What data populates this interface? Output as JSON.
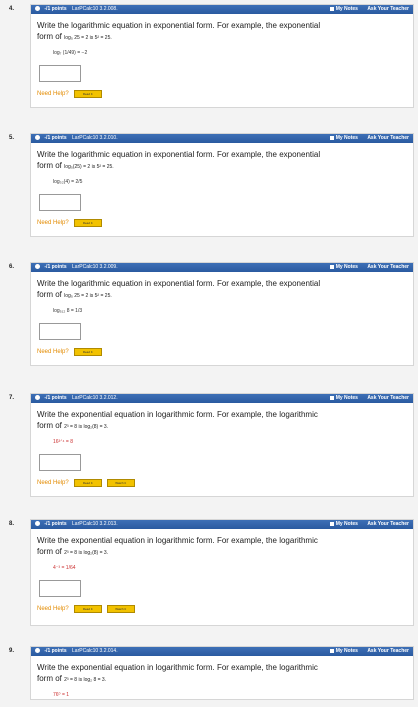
{
  "cards": [
    {
      "num": "4.",
      "pts": "-/1 points",
      "code": "LarPCalc10 3.2.008.",
      "q": "Write the logarithmic equation in exponential form. For example, the exponential",
      "form_label": "form of",
      "example": "log₅ 25 = 2  is  5² = 25.",
      "eq": "log₇ (1/49) = −2",
      "help": "Need Help?",
      "read": "Read It"
    },
    {
      "num": "5.",
      "pts": "-/1 points",
      "code": "LarPCalc10 3.2.010.",
      "q": "Write the logarithmic equation in exponential form. For example, the exponential",
      "form_label": "form of",
      "example": "log₅(25) = 2 is 5² = 25.",
      "eq": "log₃₂(4) = 2/5",
      "help": "Need Help?",
      "read": "Read It"
    },
    {
      "num": "6.",
      "pts": "-/1 points",
      "code": "LarPCalc10 3.2.009.",
      "q": "Write the logarithmic equation in exponential form. For example, the exponential",
      "form_label": "form of",
      "example": "log₅ 25 = 2 is 5² = 25.",
      "eq": "log₅₁₂ 8 = 1/3",
      "help": "Need Help?",
      "read": "Read It"
    },
    {
      "num": "7.",
      "pts": "-/1 points",
      "code": "LarPCalc10 3.2.012.",
      "q": "Write the exponential equation in logarithmic form. For example, the logarithmic",
      "form_label": "form of",
      "example": "2³ = 8 is log₂(8) = 3.",
      "eq": "16³ᐟ⁴ = 8",
      "help": "Need Help?",
      "read": "Read It",
      "watch": "Watch It"
    },
    {
      "num": "8.",
      "pts": "-/1 points",
      "code": "LarPCalc10 3.2.013.",
      "q": "Write the exponential equation in logarithmic form. For example, the logarithmic",
      "form_label": "form of",
      "example": "2³ = 8 is log₂(8) = 3.",
      "eq": "4⁻³ = 1/64",
      "help": "Need Help?",
      "read": "Read It",
      "watch": "Watch It"
    },
    {
      "num": "9.",
      "pts": "-/1 points",
      "code": "LarPCalc10 3.2.014.",
      "q": "Write the exponential equation in logarithmic form. For example, the logarithmic",
      "form_label": "form of",
      "example": "2³ = 8 is log₂ 8 = 3.",
      "eq": "76⁰ = 1"
    }
  ],
  "header_links": {
    "notes": "My Notes",
    "ask": "Ask Your Teacher"
  }
}
